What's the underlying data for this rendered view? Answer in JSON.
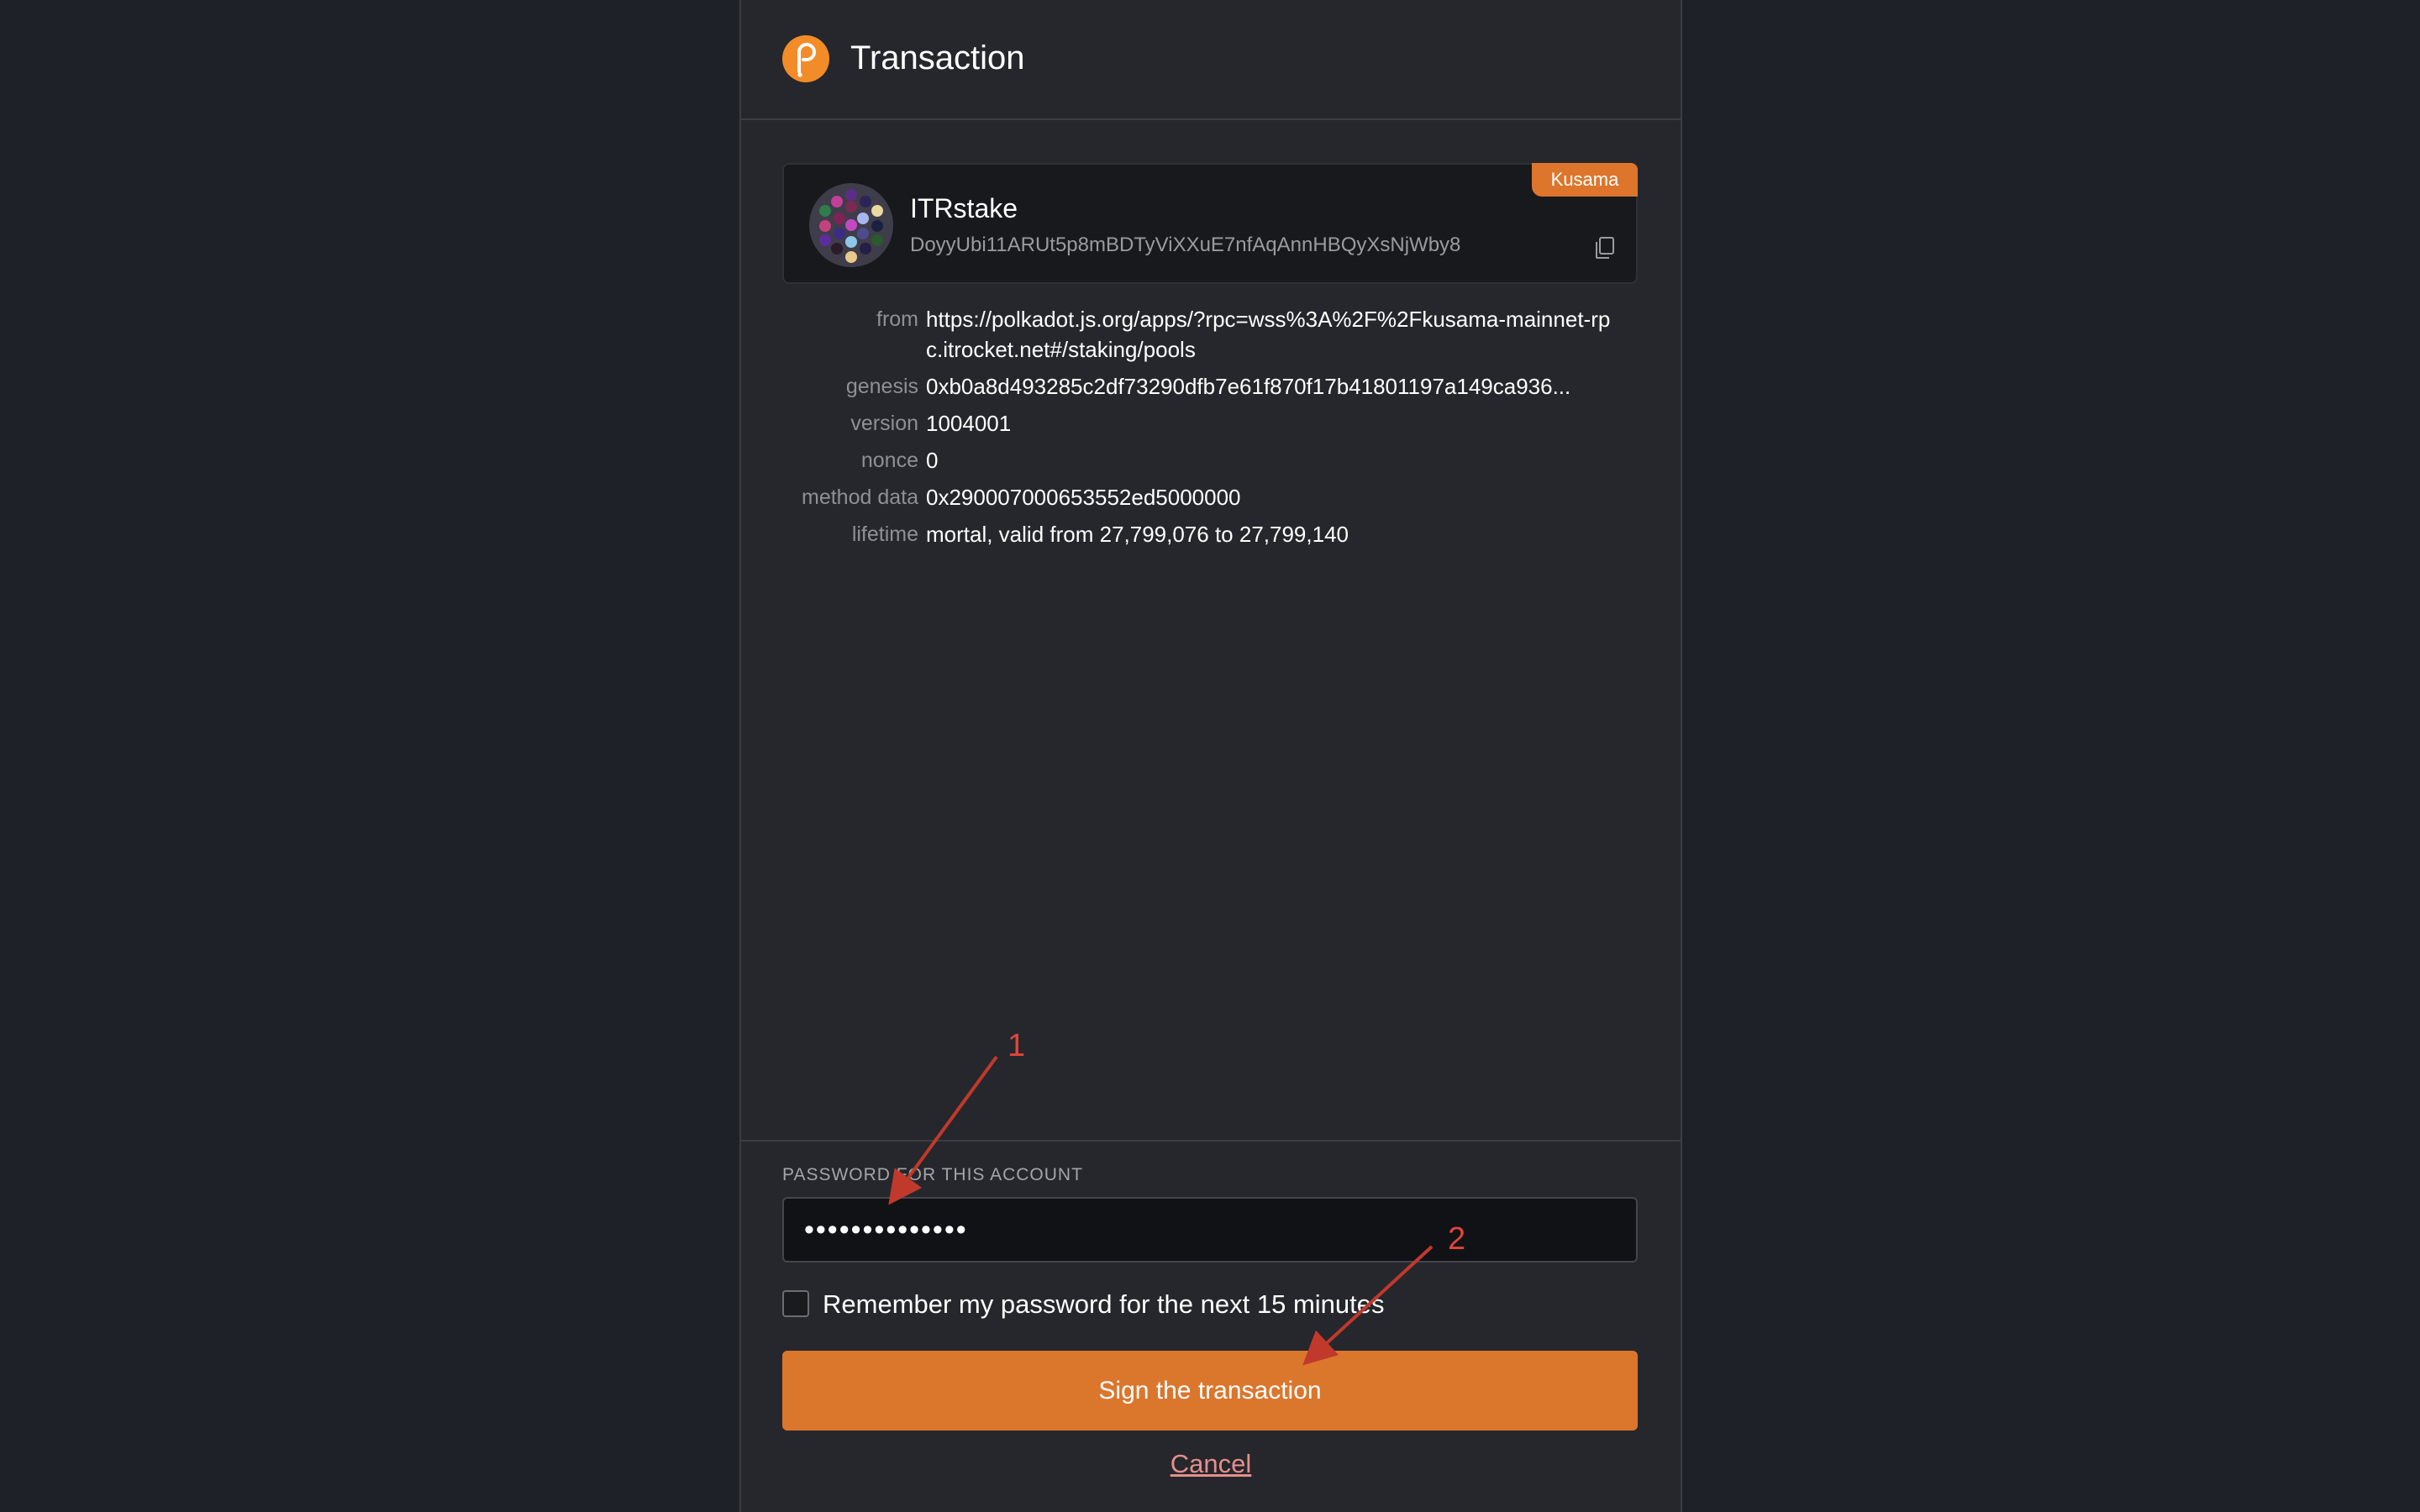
{
  "window": {
    "title": "Transaction"
  },
  "account": {
    "network_badge": "Kusama",
    "name": "ITRstake",
    "address": "DoyyUbi11ARUt5p8mBDTyViXXuE7nfAqAnnHBQyXsNjWby8"
  },
  "details": [
    {
      "label": "from",
      "value": "https://polkadot.js.org/apps/?rpc=wss%3A%2F%2Fkusama-mainnet-rpc.itrocket.net#/staking/pools"
    },
    {
      "label": "genesis",
      "value": "0xb0a8d493285c2df73290dfb7e61f870f17b41801197a149ca936..."
    },
    {
      "label": "version",
      "value": "1004001"
    },
    {
      "label": "nonce",
      "value": "0"
    },
    {
      "label": "method data",
      "value": "0x290007000653552ed5000000"
    },
    {
      "label": "lifetime",
      "value": "mortal, valid from 27,799,076 to 27,799,140"
    }
  ],
  "password": {
    "label": "PASSWORD FOR THIS ACCOUNT",
    "value": "••••••••••••••"
  },
  "remember": {
    "label": "Remember my password for the next 15 minutes",
    "checked": false
  },
  "actions": {
    "sign": "Sign the transaction",
    "cancel": "Cancel"
  },
  "annotations": {
    "marker1": "1",
    "marker2": "2"
  },
  "colors": {
    "accent": "#db762d",
    "background": "#1f2128",
    "panel": "#26272c",
    "annotation": "#c0392b"
  },
  "icons": {
    "logo": "polkadot-logo-icon",
    "copy": "copy-icon",
    "identicon": "identicon-avatar"
  }
}
